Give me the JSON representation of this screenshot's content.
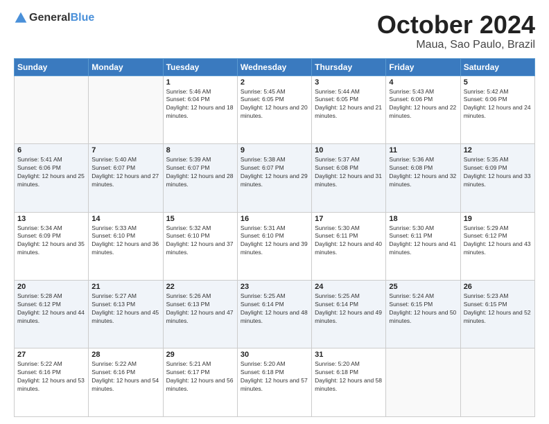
{
  "header": {
    "logo_general": "General",
    "logo_blue": "Blue",
    "month": "October 2024",
    "location": "Maua, Sao Paulo, Brazil"
  },
  "weekdays": [
    "Sunday",
    "Monday",
    "Tuesday",
    "Wednesday",
    "Thursday",
    "Friday",
    "Saturday"
  ],
  "weeks": [
    [
      {
        "day": "",
        "sunrise": "",
        "sunset": "",
        "daylight": ""
      },
      {
        "day": "",
        "sunrise": "",
        "sunset": "",
        "daylight": ""
      },
      {
        "day": "1",
        "sunrise": "Sunrise: 5:46 AM",
        "sunset": "Sunset: 6:04 PM",
        "daylight": "Daylight: 12 hours and 18 minutes."
      },
      {
        "day": "2",
        "sunrise": "Sunrise: 5:45 AM",
        "sunset": "Sunset: 6:05 PM",
        "daylight": "Daylight: 12 hours and 20 minutes."
      },
      {
        "day": "3",
        "sunrise": "Sunrise: 5:44 AM",
        "sunset": "Sunset: 6:05 PM",
        "daylight": "Daylight: 12 hours and 21 minutes."
      },
      {
        "day": "4",
        "sunrise": "Sunrise: 5:43 AM",
        "sunset": "Sunset: 6:06 PM",
        "daylight": "Daylight: 12 hours and 22 minutes."
      },
      {
        "day": "5",
        "sunrise": "Sunrise: 5:42 AM",
        "sunset": "Sunset: 6:06 PM",
        "daylight": "Daylight: 12 hours and 24 minutes."
      }
    ],
    [
      {
        "day": "6",
        "sunrise": "Sunrise: 5:41 AM",
        "sunset": "Sunset: 6:06 PM",
        "daylight": "Daylight: 12 hours and 25 minutes."
      },
      {
        "day": "7",
        "sunrise": "Sunrise: 5:40 AM",
        "sunset": "Sunset: 6:07 PM",
        "daylight": "Daylight: 12 hours and 27 minutes."
      },
      {
        "day": "8",
        "sunrise": "Sunrise: 5:39 AM",
        "sunset": "Sunset: 6:07 PM",
        "daylight": "Daylight: 12 hours and 28 minutes."
      },
      {
        "day": "9",
        "sunrise": "Sunrise: 5:38 AM",
        "sunset": "Sunset: 6:07 PM",
        "daylight": "Daylight: 12 hours and 29 minutes."
      },
      {
        "day": "10",
        "sunrise": "Sunrise: 5:37 AM",
        "sunset": "Sunset: 6:08 PM",
        "daylight": "Daylight: 12 hours and 31 minutes."
      },
      {
        "day": "11",
        "sunrise": "Sunrise: 5:36 AM",
        "sunset": "Sunset: 6:08 PM",
        "daylight": "Daylight: 12 hours and 32 minutes."
      },
      {
        "day": "12",
        "sunrise": "Sunrise: 5:35 AM",
        "sunset": "Sunset: 6:09 PM",
        "daylight": "Daylight: 12 hours and 33 minutes."
      }
    ],
    [
      {
        "day": "13",
        "sunrise": "Sunrise: 5:34 AM",
        "sunset": "Sunset: 6:09 PM",
        "daylight": "Daylight: 12 hours and 35 minutes."
      },
      {
        "day": "14",
        "sunrise": "Sunrise: 5:33 AM",
        "sunset": "Sunset: 6:10 PM",
        "daylight": "Daylight: 12 hours and 36 minutes."
      },
      {
        "day": "15",
        "sunrise": "Sunrise: 5:32 AM",
        "sunset": "Sunset: 6:10 PM",
        "daylight": "Daylight: 12 hours and 37 minutes."
      },
      {
        "day": "16",
        "sunrise": "Sunrise: 5:31 AM",
        "sunset": "Sunset: 6:10 PM",
        "daylight": "Daylight: 12 hours and 39 minutes."
      },
      {
        "day": "17",
        "sunrise": "Sunrise: 5:30 AM",
        "sunset": "Sunset: 6:11 PM",
        "daylight": "Daylight: 12 hours and 40 minutes."
      },
      {
        "day": "18",
        "sunrise": "Sunrise: 5:30 AM",
        "sunset": "Sunset: 6:11 PM",
        "daylight": "Daylight: 12 hours and 41 minutes."
      },
      {
        "day": "19",
        "sunrise": "Sunrise: 5:29 AM",
        "sunset": "Sunset: 6:12 PM",
        "daylight": "Daylight: 12 hours and 43 minutes."
      }
    ],
    [
      {
        "day": "20",
        "sunrise": "Sunrise: 5:28 AM",
        "sunset": "Sunset: 6:12 PM",
        "daylight": "Daylight: 12 hours and 44 minutes."
      },
      {
        "day": "21",
        "sunrise": "Sunrise: 5:27 AM",
        "sunset": "Sunset: 6:13 PM",
        "daylight": "Daylight: 12 hours and 45 minutes."
      },
      {
        "day": "22",
        "sunrise": "Sunrise: 5:26 AM",
        "sunset": "Sunset: 6:13 PM",
        "daylight": "Daylight: 12 hours and 47 minutes."
      },
      {
        "day": "23",
        "sunrise": "Sunrise: 5:25 AM",
        "sunset": "Sunset: 6:14 PM",
        "daylight": "Daylight: 12 hours and 48 minutes."
      },
      {
        "day": "24",
        "sunrise": "Sunrise: 5:25 AM",
        "sunset": "Sunset: 6:14 PM",
        "daylight": "Daylight: 12 hours and 49 minutes."
      },
      {
        "day": "25",
        "sunrise": "Sunrise: 5:24 AM",
        "sunset": "Sunset: 6:15 PM",
        "daylight": "Daylight: 12 hours and 50 minutes."
      },
      {
        "day": "26",
        "sunrise": "Sunrise: 5:23 AM",
        "sunset": "Sunset: 6:15 PM",
        "daylight": "Daylight: 12 hours and 52 minutes."
      }
    ],
    [
      {
        "day": "27",
        "sunrise": "Sunrise: 5:22 AM",
        "sunset": "Sunset: 6:16 PM",
        "daylight": "Daylight: 12 hours and 53 minutes."
      },
      {
        "day": "28",
        "sunrise": "Sunrise: 5:22 AM",
        "sunset": "Sunset: 6:16 PM",
        "daylight": "Daylight: 12 hours and 54 minutes."
      },
      {
        "day": "29",
        "sunrise": "Sunrise: 5:21 AM",
        "sunset": "Sunset: 6:17 PM",
        "daylight": "Daylight: 12 hours and 56 minutes."
      },
      {
        "day": "30",
        "sunrise": "Sunrise: 5:20 AM",
        "sunset": "Sunset: 6:18 PM",
        "daylight": "Daylight: 12 hours and 57 minutes."
      },
      {
        "day": "31",
        "sunrise": "Sunrise: 5:20 AM",
        "sunset": "Sunset: 6:18 PM",
        "daylight": "Daylight: 12 hours and 58 minutes."
      },
      {
        "day": "",
        "sunrise": "",
        "sunset": "",
        "daylight": ""
      },
      {
        "day": "",
        "sunrise": "",
        "sunset": "",
        "daylight": ""
      }
    ]
  ]
}
